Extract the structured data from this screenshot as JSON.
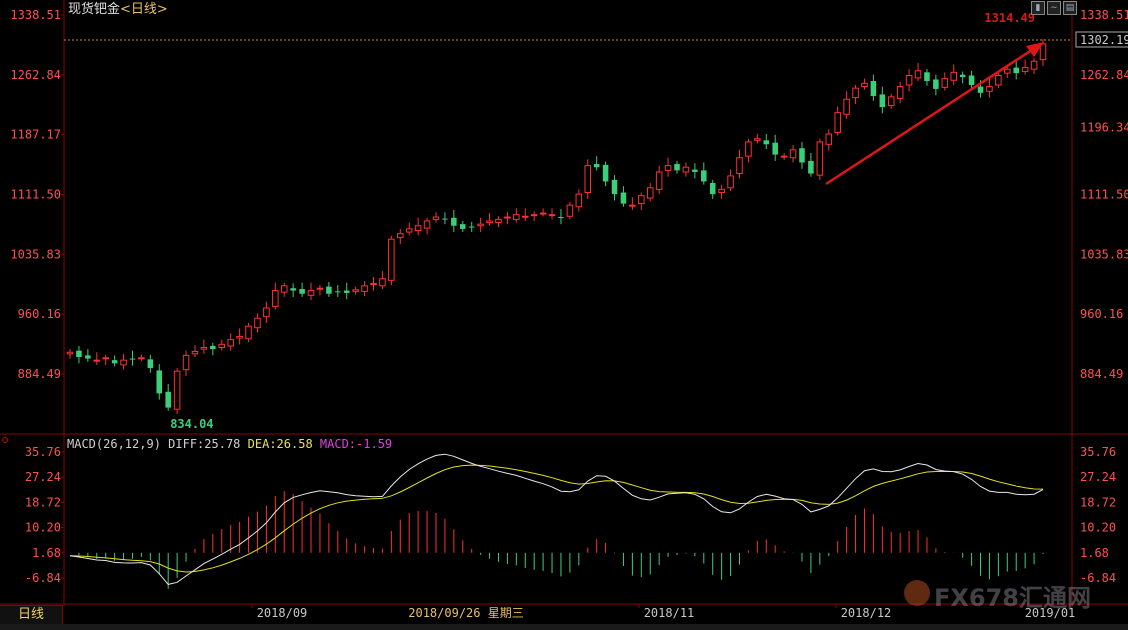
{
  "header": {
    "title": "现货钯金",
    "period": "<日线>"
  },
  "toolbar_icons": [
    "chart-type-icon",
    "line-type-icon",
    "settings-icon"
  ],
  "macd_info": {
    "label": "MACD(26,12,9)",
    "diff": "DIFF:25.78",
    "dea": "DEA:26.58",
    "macd": "MACD:-1.59"
  },
  "bottom": {
    "tab_label": "日线",
    "date_marker": "2018/09/26 星期三"
  },
  "watermark": {
    "text": "FX678汇通网"
  },
  "colors": {
    "up": "#ff3030",
    "down": "#3ad07a",
    "diff_line": "#e8e8e8",
    "dea_line": "#e0e020",
    "arrow": "#e01515",
    "grid": "#3a0000"
  },
  "chart_data": [
    {
      "type": "candlestick",
      "title": "现货钯金<日线>",
      "y_ticks": [
        884.49,
        960.16,
        1035.83,
        1111.5,
        1187.17,
        1262.84,
        1338.51
      ],
      "y_tick_labels": [
        "884.49",
        "960.16",
        "1035.83",
        "1111.50",
        "1187.17",
        "1262.84",
        "1338.51"
      ],
      "ylim": [
        834.04,
        1338.51
      ],
      "right_extra_labels": [
        "1196.34"
      ],
      "current_price_label": "1302.19",
      "current_price": 1302.19,
      "high_annotation": {
        "label": "1314.49",
        "value": 1314.49
      },
      "low_annotation": {
        "label": "834.04",
        "value": 834.04
      },
      "x_labels": [
        "2018/09",
        "2018/11",
        "2018/12",
        "2019/01"
      ],
      "closes": [
        912,
        906,
        904,
        902,
        905,
        898,
        902,
        903,
        905,
        892,
        860,
        842,
        888,
        908,
        913,
        918,
        916,
        922,
        928,
        932,
        945,
        955,
        968,
        990,
        996,
        990,
        986,
        990,
        993,
        986,
        988,
        987,
        991,
        996,
        999,
        1005,
        1055,
        1062,
        1068,
        1072,
        1078,
        1083,
        1080,
        1072,
        1068,
        1070,
        1074,
        1078,
        1080,
        1083,
        1086,
        1084,
        1086,
        1088,
        1086,
        1082,
        1098,
        1112,
        1148,
        1146,
        1128,
        1112,
        1100,
        1098,
        1110,
        1120,
        1140,
        1148,
        1142,
        1146,
        1140,
        1128,
        1112,
        1118,
        1135,
        1158,
        1178,
        1182,
        1175,
        1162,
        1160,
        1168,
        1152,
        1138,
        1178,
        1188,
        1215,
        1232,
        1246,
        1252,
        1236,
        1222,
        1235,
        1248,
        1262,
        1268,
        1255,
        1245,
        1258,
        1266,
        1260,
        1250,
        1240,
        1248,
        1262,
        1270,
        1265,
        1272,
        1280,
        1302
      ]
    },
    {
      "type": "macd",
      "params": "MACD(26,12,9)",
      "diff_last": 25.78,
      "dea_last": 26.58,
      "macd_last": -1.59,
      "y_ticks": [
        -6.84,
        1.68,
        10.2,
        18.72,
        27.24,
        35.76
      ],
      "y_tick_labels": [
        "-6.84",
        "1.68",
        "10.20",
        "18.72",
        "27.24",
        "35.76"
      ],
      "ylim": [
        -10,
        38
      ]
    }
  ]
}
